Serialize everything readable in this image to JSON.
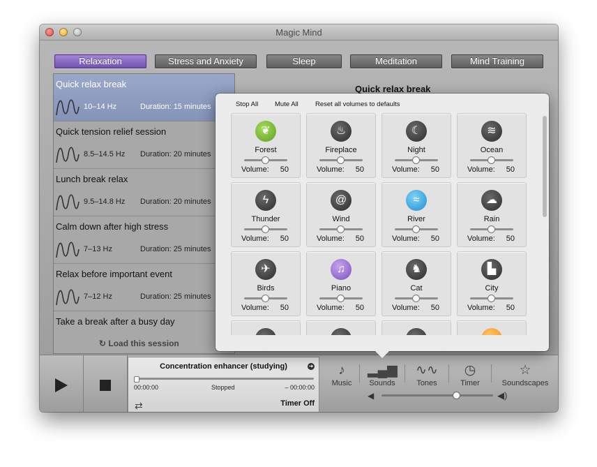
{
  "window": {
    "title": "Magic Mind"
  },
  "tabs": [
    {
      "label": "Relaxation"
    },
    {
      "label": "Stress and Anxiety"
    },
    {
      "label": "Sleep"
    },
    {
      "label": "Meditation"
    },
    {
      "label": "Mind Training"
    }
  ],
  "sessions": [
    {
      "name": "Quick relax break",
      "hz": "10–14 Hz",
      "duration": "Duration: 15 minutes"
    },
    {
      "name": "Quick tension relief session",
      "hz": "8.5–14.5 Hz",
      "duration": "Duration: 20 minutes"
    },
    {
      "name": "Lunch break relax",
      "hz": "9.5–14.8 Hz",
      "duration": "Duration: 20 minutes"
    },
    {
      "name": "Calm down after high stress",
      "hz": "7–13 Hz",
      "duration": "Duration: 25 minutes"
    },
    {
      "name": "Relax before important event",
      "hz": "7–12 Hz",
      "duration": "Duration: 25 minutes"
    },
    {
      "name": "Take a break after a busy day",
      "hz": "",
      "duration": ""
    }
  ],
  "load_session": "Load this session",
  "detail": {
    "title": "Quick relax break"
  },
  "popover": {
    "stop_all": "Stop All",
    "mute_all": "Mute All",
    "reset": "Reset all volumes to defaults",
    "volume_label": "Volume:",
    "sounds": [
      {
        "name": "Forest",
        "volume": "50",
        "icon": "leaf-icon"
      },
      {
        "name": "Fireplace",
        "volume": "50",
        "icon": "fire-icon"
      },
      {
        "name": "Night",
        "volume": "50",
        "icon": "moon-icon"
      },
      {
        "name": "Ocean",
        "volume": "50",
        "icon": "waves-icon"
      },
      {
        "name": "Thunder",
        "volume": "50",
        "icon": "lightning-icon"
      },
      {
        "name": "Wind",
        "volume": "50",
        "icon": "wind-icon"
      },
      {
        "name": "River",
        "volume": "50",
        "icon": "river-icon"
      },
      {
        "name": "Rain",
        "volume": "50",
        "icon": "rain-cloud-icon"
      },
      {
        "name": "Birds",
        "volume": "50",
        "icon": "bird-icon"
      },
      {
        "name": "Piano",
        "volume": "50",
        "icon": "piano-icon"
      },
      {
        "name": "Cat",
        "volume": "50",
        "icon": "cat-icon"
      },
      {
        "name": "City",
        "volume": "50",
        "icon": "city-icon"
      }
    ]
  },
  "player": {
    "now_playing": "Concentration enhancer (studying)",
    "elapsed": "00:00:00",
    "status": "Stopped",
    "remaining": "– 00:00:00",
    "timer": "Timer Off"
  },
  "categories": [
    {
      "label": "Music"
    },
    {
      "label": "Sounds"
    },
    {
      "label": "Tones"
    },
    {
      "label": "Timer"
    },
    {
      "label": "Soundscapes"
    }
  ]
}
